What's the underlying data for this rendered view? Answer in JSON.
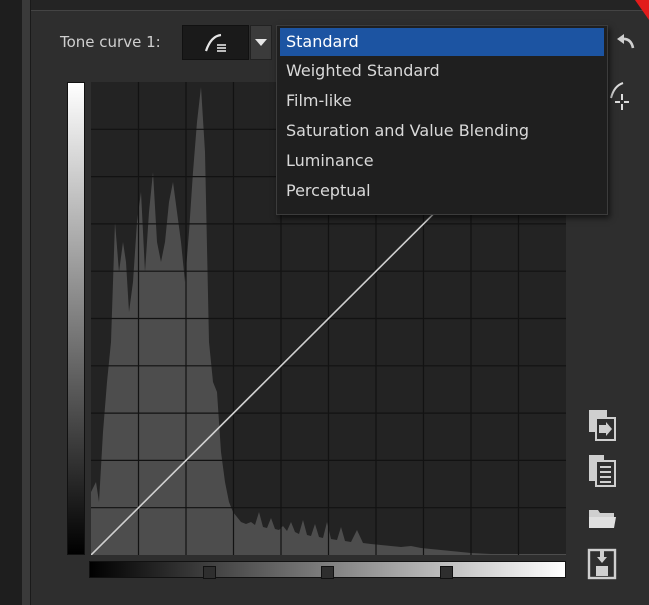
{
  "tone_curve": {
    "label": "Tone curve 1:",
    "curve_button_icon": "curve-icon",
    "dropdown_arrow_icon": "triangle-down-icon"
  },
  "curve_type_menu": {
    "items": [
      {
        "label": "Standard",
        "selected": true
      },
      {
        "label": "Weighted Standard",
        "selected": false
      },
      {
        "label": "Film-like",
        "selected": false
      },
      {
        "label": "Saturation and Value Blending",
        "selected": false
      },
      {
        "label": "Luminance",
        "selected": false
      },
      {
        "label": "Perceptual",
        "selected": false
      }
    ]
  },
  "toolbar_icons": [
    "undo-icon",
    "pick-point-icon"
  ],
  "side_icons": [
    "copy-curve-icon",
    "paste-curve-icon",
    "open-folder-icon",
    "save-icon"
  ],
  "colors": {
    "background": "#2b2b2b",
    "selection": "#1c54a2",
    "accent_red": "#e21b1b"
  }
}
